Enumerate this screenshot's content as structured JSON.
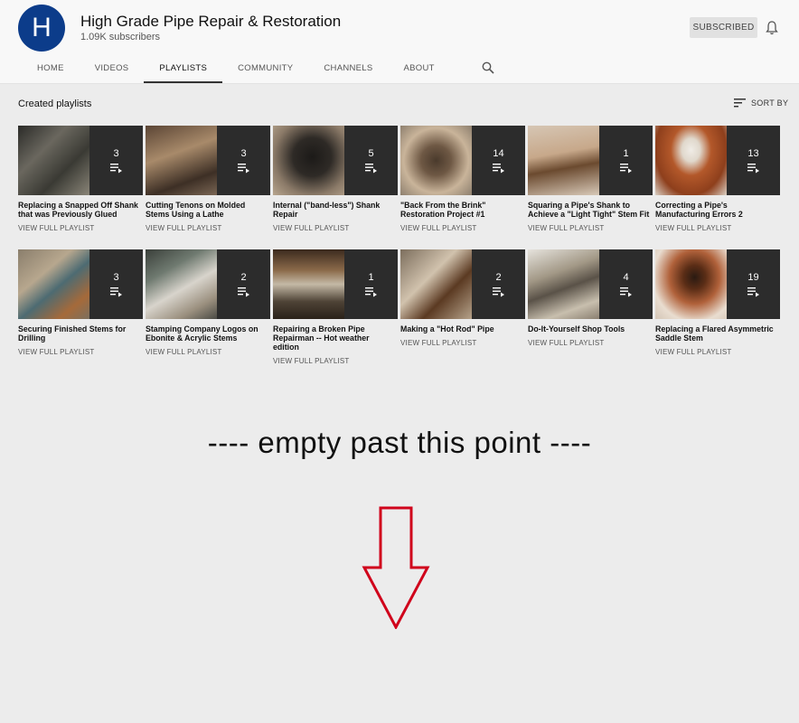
{
  "channel": {
    "avatar_letter": "H",
    "title": "High Grade Pipe Repair & Restoration",
    "subscribers": "1.09K subscribers",
    "subscribed_label": "SUBSCRIBED",
    "bell_icon": "bell-icon"
  },
  "tabs": [
    {
      "label": "HOME"
    },
    {
      "label": "VIDEOS"
    },
    {
      "label": "PLAYLISTS",
      "active": true
    },
    {
      "label": "COMMUNITY"
    },
    {
      "label": "CHANNELS"
    },
    {
      "label": "ABOUT"
    }
  ],
  "section": {
    "title": "Created playlists",
    "sort_label": "SORT BY"
  },
  "playlists": [
    {
      "count": "3",
      "title": "Replacing a Snapped Off Shank that was Previously Glued",
      "link": "VIEW FULL PLAYLIST"
    },
    {
      "count": "3",
      "title": "Cutting Tenons on Molded Stems Using a Lathe",
      "link": "VIEW FULL PLAYLIST"
    },
    {
      "count": "5",
      "title": "Internal (\"band-less\") Shank Repair",
      "link": "VIEW FULL PLAYLIST"
    },
    {
      "count": "14",
      "title": "\"Back From the Brink\" Restoration Project #1",
      "link": "VIEW FULL PLAYLIST"
    },
    {
      "count": "1",
      "title": "Squaring a Pipe's Shank to Achieve a \"Light Tight\" Stem Fit",
      "link": "VIEW FULL PLAYLIST"
    },
    {
      "count": "13",
      "title": "Correcting a Pipe's Manufacturing Errors 2",
      "link": "VIEW FULL PLAYLIST"
    },
    {
      "count": "3",
      "title": "Securing Finished Stems for Drilling",
      "link": "VIEW FULL PLAYLIST"
    },
    {
      "count": "2",
      "title": "Stamping Company Logos on Ebonite & Acrylic Stems",
      "link": "VIEW FULL PLAYLIST"
    },
    {
      "count": "1",
      "title": "Repairing a Broken Pipe Repairman -- Hot weather edition",
      "link": "VIEW FULL PLAYLIST"
    },
    {
      "count": "2",
      "title": "Making a \"Hot Rod\" Pipe",
      "link": "VIEW FULL PLAYLIST"
    },
    {
      "count": "4",
      "title": "Do-It-Yourself Shop Tools",
      "link": "VIEW FULL PLAYLIST"
    },
    {
      "count": "19",
      "title": "Replacing a Flared Asymmetric Saddle Stem",
      "link": "VIEW FULL PLAYLIST"
    }
  ],
  "annotation": {
    "text": "----  empty past this point  ----",
    "arrow_color": "#d0021b"
  },
  "colors": {
    "avatar": "#0c3c8a",
    "background": "#ececec"
  }
}
